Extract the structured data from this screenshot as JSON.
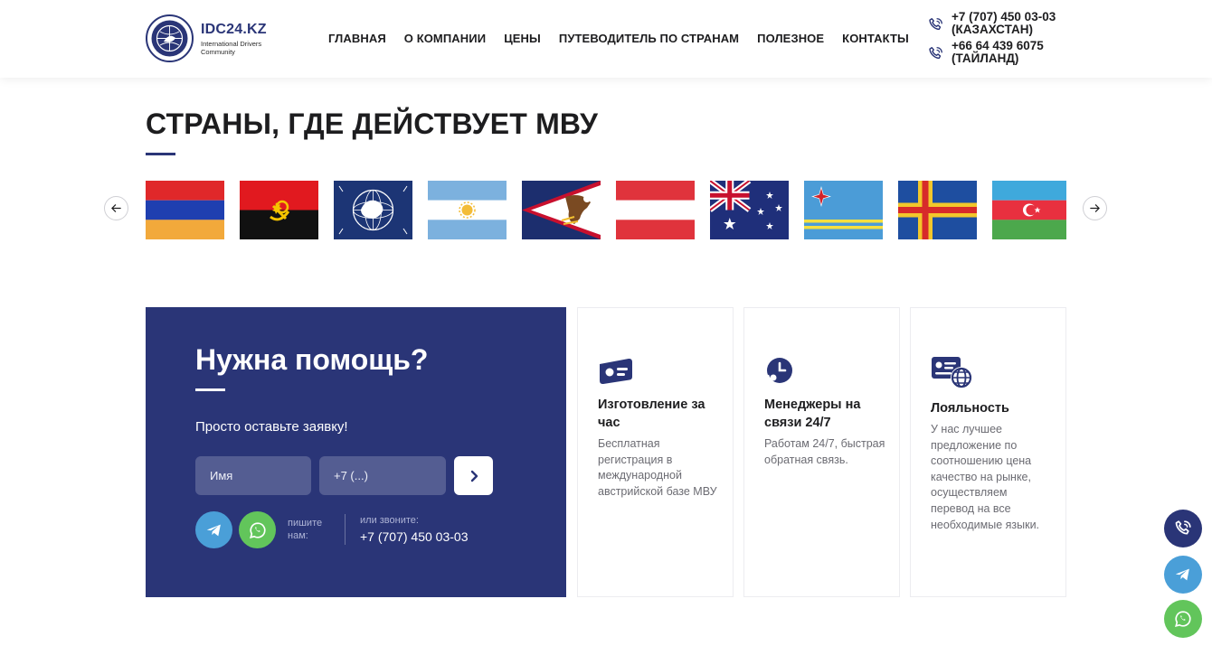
{
  "header": {
    "logo_title": "IDC24.KZ",
    "logo_subtitle": "International Drivers Community",
    "nav": [
      "ГЛАВНАЯ",
      "О КОМПАНИИ",
      "ЦЕНЫ",
      "ПУТЕВОДИТЕЛЬ ПО СТРАНАМ",
      "ПОЛЕЗНОЕ",
      "КОНТАКТЫ"
    ],
    "phones": [
      {
        "number": "+7 (707) 450 03-03",
        "country": "(КАЗАХСТАН)"
      },
      {
        "number": "+66 64 439 6075",
        "country": "(ТАЙЛАНД)"
      }
    ]
  },
  "countries": {
    "title": "СТРАНЫ, ГДЕ ДЕЙСТВУЕТ МВУ",
    "flags": [
      "armenia-flag",
      "angola-flag",
      "antarctica-flag",
      "argentina-flag",
      "american-samoa-flag",
      "austria-flag",
      "australia-flag",
      "aruba-flag",
      "aland-flag",
      "azerbaijan-flag"
    ]
  },
  "help": {
    "title": "Нужна помощь?",
    "subtitle": "Просто оставьте заявку!",
    "name_placeholder": "Имя",
    "phone_placeholder": "+7 (...)",
    "write_label": "пишите нам:",
    "call_label": "или звоните:",
    "call_number": "+7 (707) 450 03-03"
  },
  "features": [
    {
      "title": "Изготовление за час",
      "text": "Бесплатная регистрация в международной австрийской базе МВУ"
    },
    {
      "title": "Менеджеры на связи 24/7",
      "text": "Работам 24/7, быстрая обратная связь."
    },
    {
      "title": "Лояльность",
      "text": "У нас лучшее предложение по соотношению цена качество на рынке, осуществляем перевод на все необходимые языки."
    }
  ],
  "colors": {
    "brand": "#2a3577",
    "telegram": "#4a9fd8",
    "whatsapp": "#62c55b"
  }
}
